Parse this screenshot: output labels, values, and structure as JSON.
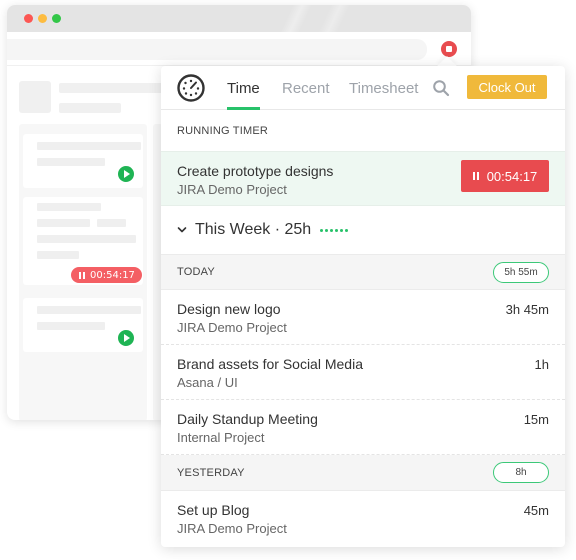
{
  "browser": {
    "window_controls": [
      "close",
      "minimize",
      "maximize"
    ],
    "mini_timer": "00:54:17"
  },
  "popup": {
    "tabs": [
      {
        "label": "Time",
        "active": true
      },
      {
        "label": "Recent",
        "active": false
      },
      {
        "label": "Timesheet",
        "active": false
      }
    ],
    "search_icon": "search-icon",
    "clock_out_label": "Clock Out",
    "running_timer": {
      "section_label": "RUNNING TIMER",
      "title": "Create prototype designs",
      "project": "JIRA Demo Project",
      "elapsed": "00:54:17"
    },
    "week": {
      "title": "This Week · 25h",
      "dots": 6
    },
    "days": [
      {
        "label": "TODAY",
        "total": "5h 55m",
        "entries": [
          {
            "title": "Design new logo",
            "project": "JIRA Demo Project",
            "duration": "3h 45m"
          },
          {
            "title": "Brand assets for Social Media",
            "project": "Asana / UI",
            "duration": "1h"
          },
          {
            "title": "Daily Standup Meeting",
            "project": "Internal Project",
            "duration": "15m"
          }
        ]
      },
      {
        "label": "YESTERDAY",
        "total": "8h",
        "entries": [
          {
            "title": "Set up Blog",
            "project": "JIRA Demo Project",
            "duration": "45m"
          }
        ]
      }
    ]
  },
  "colors": {
    "accent_green": "#28c26a",
    "clock_out": "#f0b93b",
    "timer_red": "#e84b4f",
    "running_bg": "#eef8f2"
  }
}
